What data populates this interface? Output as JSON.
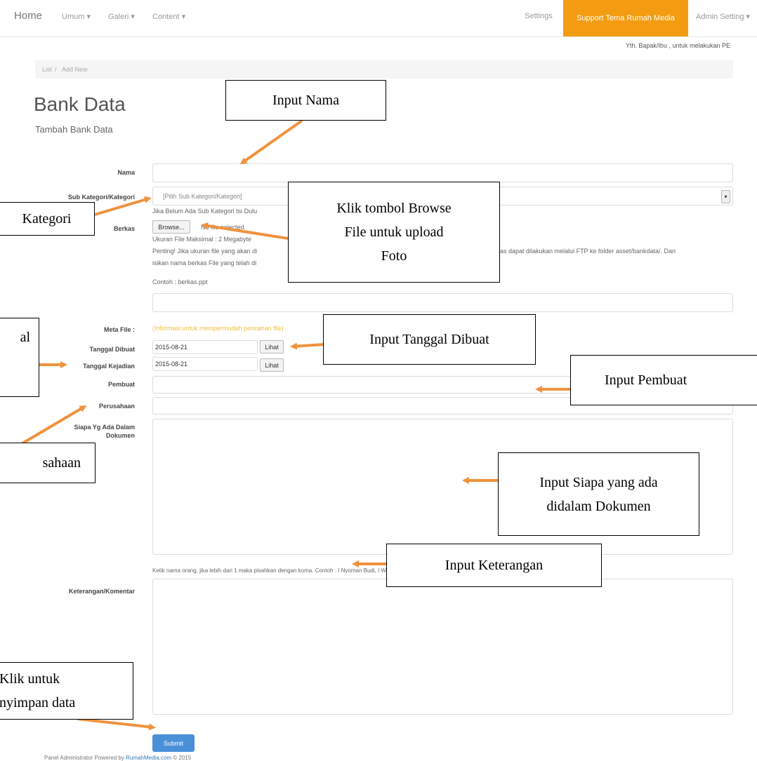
{
  "navbar": {
    "home": "Home",
    "items": [
      "Umum",
      "Galeri",
      "Content"
    ],
    "settings": "Settings",
    "support": "Support Tema Rumah Media",
    "admin": "Admin Setting"
  },
  "welcome": "Yth. Bapak/Ibu , untuk melakukan PE",
  "breadcrumb": [
    "List",
    "Add New"
  ],
  "page": {
    "title": "Bank Data",
    "subtitle": "Tambah Bank Data"
  },
  "form": {
    "nama_label": "Nama",
    "kategori_label": "Sub Kategori/Kategori",
    "kategori_select": "[Pilih Sub Kategori/Kategori]",
    "kategori_help": "Jika Belum Ada Sub Kategori tsi Dulu",
    "berkas_label": "Berkas",
    "browse": "Browse...",
    "no_file": "No file selected.",
    "ukuran": "Ukuran File Maksimal : 2 Megabyte",
    "penting_1": "Penting! Jika ukuran file yang akan di",
    "penting_1b": "as dapat dilakukan melalui FTP ke folder asset/bankdata/. Dan",
    "penting_2": "isikan nama berkas File yang telah di",
    "contoh": "Contoh : berkas.ppt",
    "meta_label": "Meta File :",
    "meta_hint": "(Informasi untuk mempermudah pencarian file)",
    "tgl_dibuat_label": "Tanggal Dibuat",
    "tgl_dibuat_value": "2015-08-21",
    "tgl_kejadian_label": "Tanggal Kejadian",
    "tgl_kejadian_value": "2015-08-21",
    "lihat": "Lihat",
    "pembuat_label": "Pembuat",
    "perusahaan_label": "Perusahaan",
    "siapa_label_1": "Siapa Yg Ada Dalam",
    "siapa_label_2": "Dokumen",
    "siapa_help": "Ketik nama orang, jika lebih dari 1 maka pisahkan dengan koma. Contoh : I Nyoman Budi, I Wayan Badu",
    "keterangan_label": "Keterangan/Komentar",
    "submit": "Submit"
  },
  "footer": {
    "text": "Panel Administrator Powered by",
    "link": "RumahMedia.com",
    "copy": "© 2015"
  },
  "callouts": {
    "input_nama": "Input Nama",
    "kategori": "Kategori",
    "browse_1": "Klik tombol Browse",
    "browse_2": "File untuk upload",
    "browse_3": "Foto",
    "tanggal_dibuat": "Input Tanggal Dibuat",
    "tanggal_kejadian": "al",
    "pembuat": "Input Pembuat",
    "perusahaan": "sahaan",
    "siapa_1": "Input Siapa yang ada",
    "siapa_2": "didalam Dokumen",
    "keterangan": "Input Keterangan",
    "simpan_1": "Klik untuk",
    "simpan_2": "nyimpan data"
  },
  "colors": {
    "accent": "#f39c12",
    "arrow": "#f0923e",
    "submit": "#4a90d9"
  }
}
